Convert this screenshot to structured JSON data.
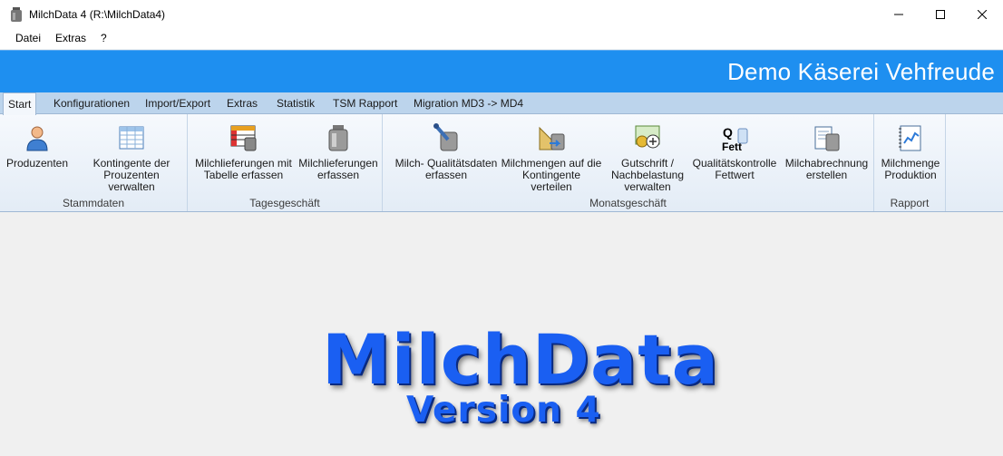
{
  "window": {
    "title": "MilchData 4 (R:\\MilchData4)",
    "icon": "milk-can-icon",
    "controls": [
      "minimize-icon",
      "maximize-icon",
      "close-icon"
    ]
  },
  "menu": [
    "Datei",
    "Extras",
    "?"
  ],
  "banner": {
    "title": "Demo Käserei Vehfreude",
    "color": "#1e8ff0"
  },
  "tabs": [
    "Start",
    "Konfigurationen",
    "Import/Export",
    "Extras",
    "Statistik",
    "TSM Rapport",
    "Migration MD3 -> MD4"
  ],
  "active_tab": "Start",
  "ribbon": {
    "groups": [
      {
        "label": "Stammdaten",
        "buttons": [
          {
            "label": "Produzenten",
            "icon": "producer-person-icon"
          },
          {
            "label": "Kontingente der\nProuzenten verwalten",
            "icon": "quota-table-icon"
          }
        ]
      },
      {
        "label": "Tagesgeschäft",
        "buttons": [
          {
            "label": "Milchlieferungen mit\nTabelle erfassen",
            "icon": "milk-delivery-table-icon"
          },
          {
            "label": "Milchlieferungen\nerfassen",
            "icon": "milk-can-icon"
          }
        ]
      },
      {
        "label": "Monatsgeschäft",
        "buttons": [
          {
            "label": "Milch- Qualitätsdaten\nerfassen",
            "icon": "quality-pipette-icon"
          },
          {
            "label": "Milchmengen auf die\nKontingente verteilen",
            "icon": "distribute-ruler-icon"
          },
          {
            "label": "Gutschrift /\nNachbelastung\nverwalten",
            "icon": "credit-money-icon"
          },
          {
            "label": "Qualitätskontrolle\nFettwert",
            "icon": "quality-fat-icon",
            "icon_text": [
              "Q",
              "Fett"
            ]
          },
          {
            "label": "Milchabrechnung\nerstellen",
            "icon": "milk-billing-icon"
          }
        ]
      },
      {
        "label": "Rapport",
        "buttons": [
          {
            "label": "Milchmenge\nProduktion",
            "icon": "production-chart-icon"
          }
        ]
      }
    ]
  },
  "logo": {
    "title": "MilchData",
    "version": "Version 4"
  }
}
